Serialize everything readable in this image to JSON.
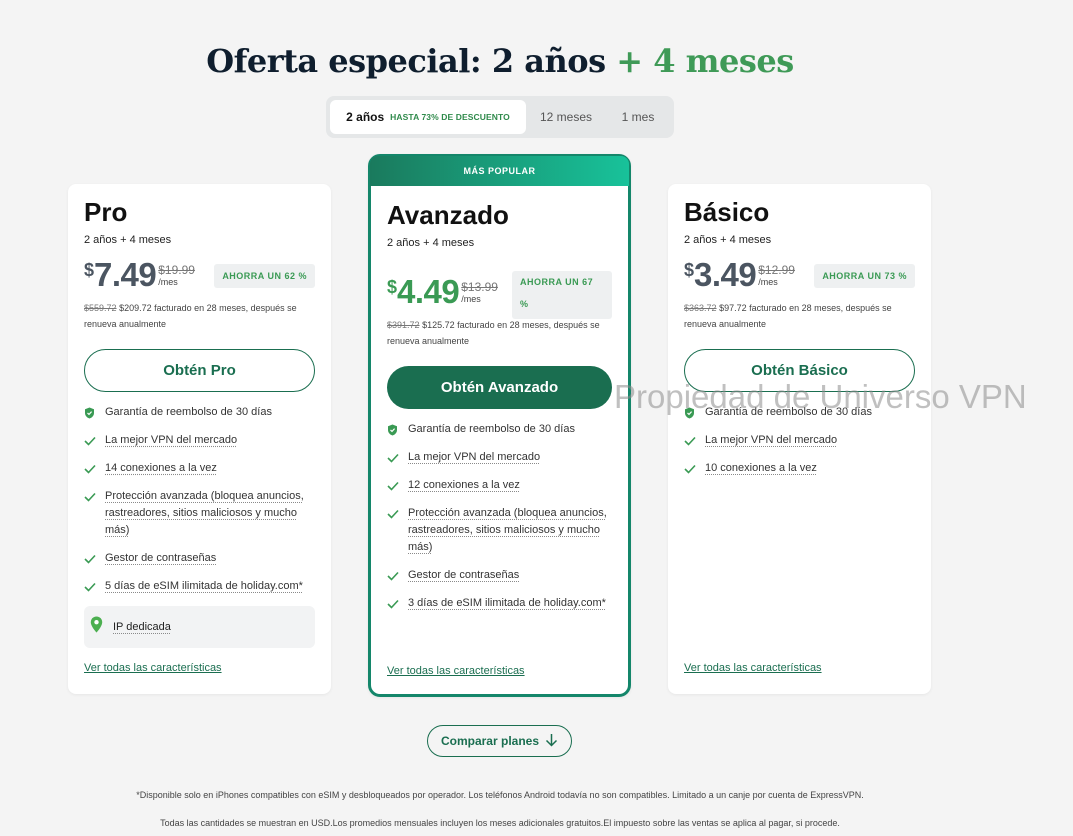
{
  "header": {
    "title_prefix": "Oferta especial: 2 años",
    "title_accent": "+ 4 meses"
  },
  "tabs": [
    {
      "label": "2 años",
      "badge": "HASTA 73% DE DESCUENTO",
      "active": true
    },
    {
      "label": "12 meses"
    },
    {
      "label": "1 mes"
    }
  ],
  "plans": {
    "pro": {
      "name": "Pro",
      "term": "2 años + 4 meses",
      "currency": "$",
      "price": "7.49",
      "old_price": "$19.99",
      "per": "/mes",
      "save": "AHORRA UN 62 %",
      "billing_old": "$559.72",
      "billing_text": "$209.72 facturado en 28 meses, después se renueva anualmente",
      "cta": "Obtén Pro",
      "features": [
        "Garantía de reembolso de 30 días",
        "La mejor VPN del mercado",
        "14 conexiones a la vez",
        "Protección avanzada (bloquea anuncios, rastreadores, sitios maliciosos y mucho más)",
        "Gestor de contraseñas",
        "5 días de eSIM ilimitada de holiday.com*"
      ],
      "extra": "IP dedicada",
      "see_all": "Ver todas las características"
    },
    "advanced": {
      "banner": "MÁS POPULAR",
      "name": "Avanzado",
      "term": "2 años + 4 meses",
      "currency": "$",
      "price": "4.49",
      "old_price": "$13.99",
      "per": "/mes",
      "save": "AHORRA UN 67 %",
      "billing_old": "$391.72",
      "billing_text": "$125.72 facturado en 28 meses, después se renueva anualmente",
      "cta": "Obtén Avanzado",
      "features": [
        "Garantía de reembolso de 30 días",
        "La mejor VPN del mercado",
        "12 conexiones a la vez",
        "Protección avanzada (bloquea anuncios, rastreadores, sitios maliciosos y mucho más)",
        "Gestor de contraseñas",
        "3 días de eSIM ilimitada de holiday.com*"
      ],
      "see_all": "Ver todas las características"
    },
    "basic": {
      "name": "Básico",
      "term": "2 años + 4 meses",
      "currency": "$",
      "price": "3.49",
      "old_price": "$12.99",
      "per": "/mes",
      "save": "AHORRA UN 73 %",
      "billing_old": "$363.72",
      "billing_text": "$97.72 facturado en 28 meses, después se renueva anualmente",
      "cta": "Obtén Básico",
      "features": [
        "Garantía de reembolso de 30 días",
        "La mejor VPN del mercado",
        "10 conexiones a la vez"
      ],
      "see_all": "Ver todas las características"
    }
  },
  "compare_label": "Comparar planes",
  "footnotes": [
    "*Disponible solo en iPhones compatibles con eSIM y desbloqueados por operador. Los teléfonos Android todavía no son compatibles. Limitado a un canje por cuenta de ExpressVPN.",
    "Todas las cantidades se muestran en USD.Los promedios mensuales incluyen los meses adicionales gratuitos.El impuesto sobre las ventas se aplica al pagar, si procede."
  ],
  "watermark": "Propiedad de Universo VPN",
  "colors": {
    "brand": "#1a6e50",
    "accent": "#3f9a57",
    "banner_from": "#1a7a5d",
    "banner_to": "#18c29a"
  },
  "icons": {
    "feature": "check-icon",
    "guarantee": "shield-icon",
    "ip": "location-pin-icon",
    "compare": "arrow-down-icon"
  }
}
